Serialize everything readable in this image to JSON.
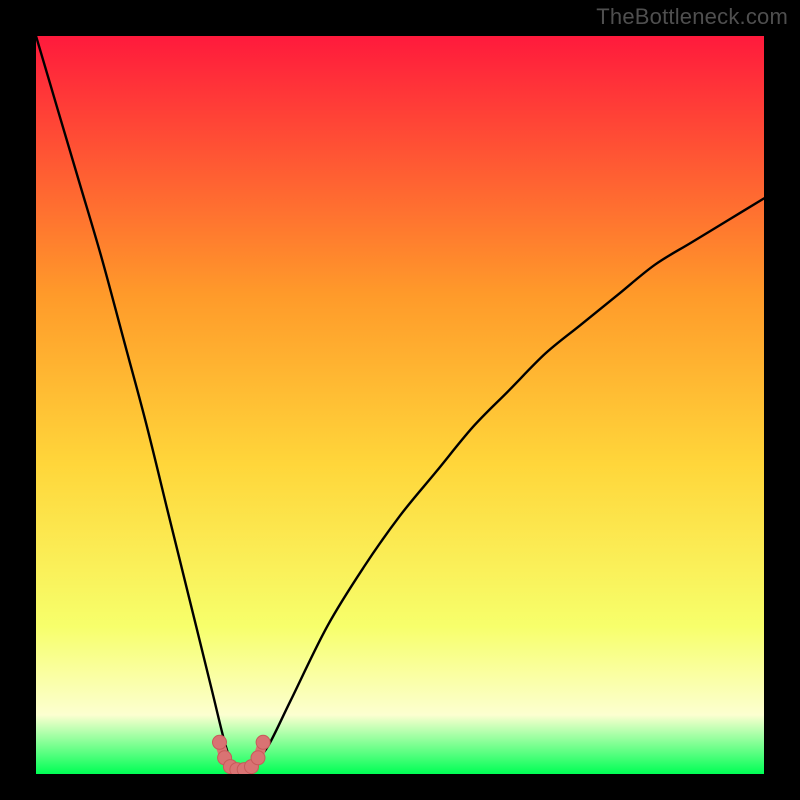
{
  "watermark": "TheBottleneck.com",
  "colors": {
    "page_bg": "#000000",
    "gradient_top": "#ff1a3c",
    "gradient_mid_upper": "#ff9a2a",
    "gradient_mid": "#ffd63a",
    "gradient_lower": "#f7ff6b",
    "gradient_pale": "#fcffd0",
    "gradient_bottom": "#00ff55",
    "curve_stroke": "#000000",
    "marker_fill": "#d97373",
    "marker_stroke": "#c85a5a"
  },
  "chart_data": {
    "type": "line",
    "title": "",
    "xlabel": "",
    "ylabel": "",
    "xlim": [
      0,
      100
    ],
    "ylim": [
      0,
      100
    ],
    "series": [
      {
        "name": "bottleneck-curve",
        "x": [
          0,
          3,
          6,
          9,
          12,
          15,
          18,
          21,
          24,
          26,
          27,
          28,
          29,
          30,
          32,
          35,
          40,
          45,
          50,
          55,
          60,
          65,
          70,
          75,
          80,
          85,
          90,
          95,
          100
        ],
        "y": [
          100,
          90,
          80,
          70,
          59,
          48,
          36,
          24,
          12,
          4,
          1.5,
          0.8,
          0.8,
          1.5,
          4,
          10,
          20,
          28,
          35,
          41,
          47,
          52,
          57,
          61,
          65,
          69,
          72,
          75,
          78
        ]
      }
    ],
    "markers": {
      "name": "optimal-zone-dots",
      "x": [
        25.2,
        25.9,
        26.7,
        27.6,
        28.6,
        29.6,
        30.5,
        31.2
      ],
      "y": [
        4.3,
        2.2,
        1.0,
        0.6,
        0.6,
        1.0,
        2.2,
        4.3
      ]
    }
  }
}
